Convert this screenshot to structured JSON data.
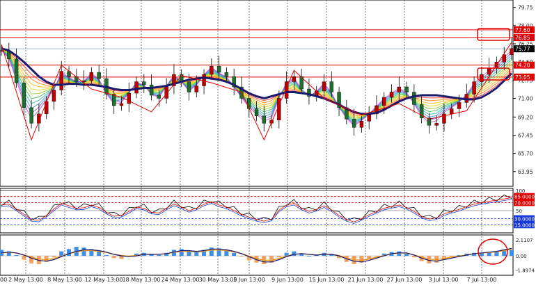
{
  "chart_data": {
    "type": "candlestick",
    "x_tick_labels": [
      "2 May 13:00",
      "8 May 13:00",
      "12 May 13:00",
      "18 May 13:00",
      "24 May 13:00",
      "30 May 13:00",
      "5 Jun 13:00",
      "9 Jun 13:00",
      "15 Jun 13:00",
      "21 Jun 13:00",
      "27 Jun 13:00",
      "3 Jul 13:00",
      "7 Jul 13:00"
    ],
    "x_left_label": "00",
    "price_panel": {
      "ylim": [
        62.8,
        80.2
      ],
      "y_ticks": [
        {
          "value": 79.75,
          "label": "79.75"
        },
        {
          "value": 78.0,
          "label": "78.00"
        },
        {
          "value": 76.25,
          "label": "76.25"
        },
        {
          "value": 74.5,
          "label": "74.50"
        },
        {
          "value": 72.75,
          "label": "72.75"
        },
        {
          "value": 71.0,
          "label": "71.00"
        },
        {
          "value": 69.2,
          "label": "69.20"
        },
        {
          "value": 67.45,
          "label": "67.45"
        },
        {
          "value": 65.7,
          "label": "65.70"
        },
        {
          "value": 63.95,
          "label": "63.95"
        }
      ],
      "level_lines": [
        {
          "value": 77.6,
          "label": "77.60"
        },
        {
          "value": 76.85,
          "label": "76.85"
        },
        {
          "value": 74.2,
          "label": "74.20"
        },
        {
          "value": 73.05,
          "label": "73.05"
        }
      ],
      "last_price": {
        "value": 75.77,
        "label": "75.77"
      },
      "close_series": [
        75.6,
        74.8,
        72.5,
        70.1,
        68.6,
        69.5,
        70.7,
        71.8,
        73.6,
        73.1,
        72.6,
        72.7,
        73.5,
        72.9,
        71.4,
        70.3,
        70.5,
        71.5,
        72.6,
        72.3,
        71.3,
        71.0,
        72.2,
        73.3,
        72.6,
        71.6,
        72.2,
        73.3,
        74.1,
        73.5,
        73.1,
        72.1,
        71.0,
        70.0,
        69.3,
        68.6,
        68.9,
        71.0,
        72.6,
        73.1,
        71.9,
        71.2,
        71.7,
        72.6,
        71.6,
        70.1,
        69.0,
        68.2,
        68.8,
        69.5,
        70.3,
        71.1,
        71.6,
        72.1,
        71.6,
        70.4,
        69.1,
        68.4,
        68.6,
        69.5,
        70.0,
        70.6,
        71.4,
        72.6,
        73.3,
        73.9,
        74.5,
        75.2,
        75.8
      ],
      "ma_series": [
        75.8,
        75.6,
        75.1,
        74.5,
        73.8,
        73.1,
        72.6,
        72.3,
        72.3,
        72.4,
        72.4,
        72.3,
        72.3,
        72.2,
        72.1,
        71.9,
        71.8,
        71.8,
        71.9,
        72.0,
        72.0,
        72.1,
        72.2,
        72.4,
        72.6,
        72.8,
        72.9,
        73.0,
        72.9,
        72.8,
        72.6,
        72.3,
        71.9,
        71.5,
        71.2,
        71.0,
        71.2,
        71.4,
        71.6,
        71.6,
        71.5,
        71.4,
        71.2,
        71.0,
        70.7,
        70.4,
        70.0,
        69.7,
        69.5,
        69.5,
        69.6,
        69.9,
        70.3,
        70.7,
        71.0,
        71.2,
        71.3,
        71.3,
        71.3,
        71.2,
        71.1,
        71.0,
        70.9,
        70.9,
        71.1,
        71.5,
        72.0,
        72.7,
        73.4
      ]
    },
    "rsi_panel": {
      "ylim": [
        0,
        100
      ],
      "levels": [
        {
          "value": 100,
          "label": "100"
        },
        {
          "value": 85,
          "label": "85.0000"
        },
        {
          "value": 70,
          "label": "70.0000"
        },
        {
          "value": 50,
          "label": "50"
        },
        {
          "value": 30,
          "label": "30.0000"
        },
        {
          "value": 15,
          "label": "15.0000"
        }
      ],
      "series": [
        68,
        70,
        58,
        45,
        32,
        30,
        42,
        58,
        72,
        66,
        60,
        61,
        68,
        62,
        50,
        40,
        42,
        52,
        63,
        60,
        50,
        48,
        60,
        70,
        63,
        54,
        60,
        70,
        76,
        68,
        63,
        54,
        45,
        38,
        32,
        28,
        33,
        55,
        68,
        72,
        60,
        52,
        57,
        66,
        56,
        42,
        32,
        26,
        34,
        44,
        52,
        60,
        64,
        68,
        62,
        52,
        40,
        33,
        36,
        46,
        52,
        57,
        64,
        70,
        74,
        77,
        80,
        83,
        86
      ]
    },
    "macd_panel": {
      "ylim": [
        -2.3,
        2.5
      ],
      "labels": [
        {
          "value": 2.1107,
          "label": "2.1107"
        },
        {
          "value": 0.0,
          "label": "0.00"
        },
        {
          "value": -1.8974,
          "label": "-1.8974"
        }
      ],
      "histogram": [
        0.8,
        0.6,
        0.1,
        -0.5,
        -1.0,
        -1.1,
        -0.8,
        -0.2,
        0.6,
        0.9,
        1.2,
        1.1,
        0.9,
        0.6,
        0.1,
        -0.3,
        -0.4,
        -0.1,
        0.3,
        0.4,
        0.2,
        0.1,
        0.4,
        0.8,
        0.9,
        0.6,
        0.5,
        0.8,
        1.1,
        1.0,
        0.8,
        0.4,
        -0.1,
        -0.6,
        -0.9,
        -1.1,
        -0.9,
        -0.2,
        0.4,
        0.6,
        0.3,
        0.0,
        0.1,
        0.4,
        0.2,
        -0.3,
        -0.8,
        -1.1,
        -0.9,
        -0.5,
        -0.1,
        0.3,
        0.5,
        0.6,
        0.3,
        -0.2,
        -0.7,
        -1.0,
        -0.9,
        -0.5,
        -0.2,
        0.1,
        0.3,
        0.4,
        0.4,
        0.5,
        0.6,
        0.7,
        0.8
      ],
      "signal": [
        0.4,
        0.5,
        0.4,
        0.1,
        -0.3,
        -0.6,
        -0.7,
        -0.5,
        -0.1,
        0.3,
        0.6,
        0.8,
        0.8,
        0.7,
        0.5,
        0.2,
        0.0,
        -0.1,
        0.0,
        0.2,
        0.2,
        0.2,
        0.3,
        0.5,
        0.7,
        0.7,
        0.6,
        0.7,
        0.9,
        0.9,
        0.8,
        0.6,
        0.3,
        -0.1,
        -0.5,
        -0.8,
        -0.8,
        -0.5,
        -0.1,
        0.2,
        0.3,
        0.2,
        0.1,
        0.2,
        0.2,
        0.0,
        -0.4,
        -0.7,
        -0.8,
        -0.6,
        -0.3,
        0.0,
        0.3,
        0.4,
        0.4,
        0.1,
        -0.3,
        -0.6,
        -0.7,
        -0.5,
        -0.3,
        -0.1,
        0.1,
        0.3,
        0.4,
        0.5,
        0.6,
        0.8,
        1.0
      ]
    }
  }
}
